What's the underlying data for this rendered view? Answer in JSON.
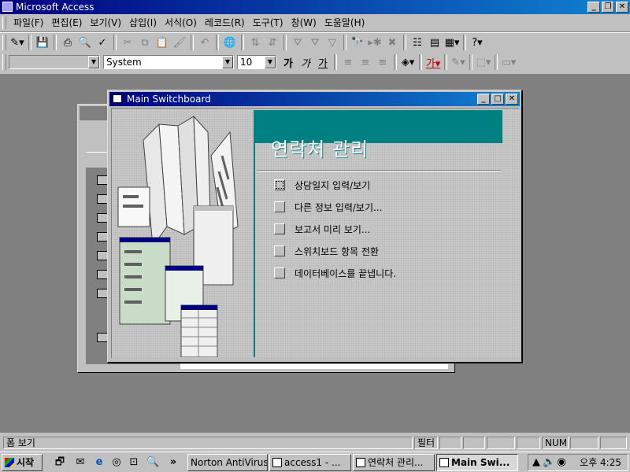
{
  "app": {
    "title": "Microsoft Access"
  },
  "menu": [
    "파일(F)",
    "편집(E)",
    "보기(V)",
    "삽입(I)",
    "서식(O)",
    "레코드(R)",
    "도구(T)",
    "창(W)",
    "도움말(H)"
  ],
  "format_toolbar": {
    "object_combo": "",
    "font_combo": "System",
    "size_combo": "10",
    "bold": "가",
    "italic": "가",
    "underline": "가"
  },
  "switchboard": {
    "window_title": "Main Switchboard",
    "heading": "연락처 관리",
    "items": [
      {
        "label": "상담일지 입력/보기"
      },
      {
        "label": "다른 정보 입력/보기..."
      },
      {
        "label": "보고서 미리 보기..."
      },
      {
        "label": "스위치보드 항목 전환"
      },
      {
        "label": "데이터베이스를 끝냅니다."
      }
    ]
  },
  "status": {
    "left": "폼 보기",
    "filter": "필터",
    "num": "NUM"
  },
  "taskbar": {
    "start": "시작",
    "more": "»",
    "buttons": [
      {
        "label": "Norton AntiVirus"
      },
      {
        "label": "access1 - ..."
      },
      {
        "label": "연락처 관리..."
      },
      {
        "label": "Main Swi..."
      }
    ],
    "clock": "오후 4:25"
  },
  "colors": {
    "title_bar": "#000080",
    "switchboard_accent": "#008080",
    "desktop": "#808080"
  }
}
